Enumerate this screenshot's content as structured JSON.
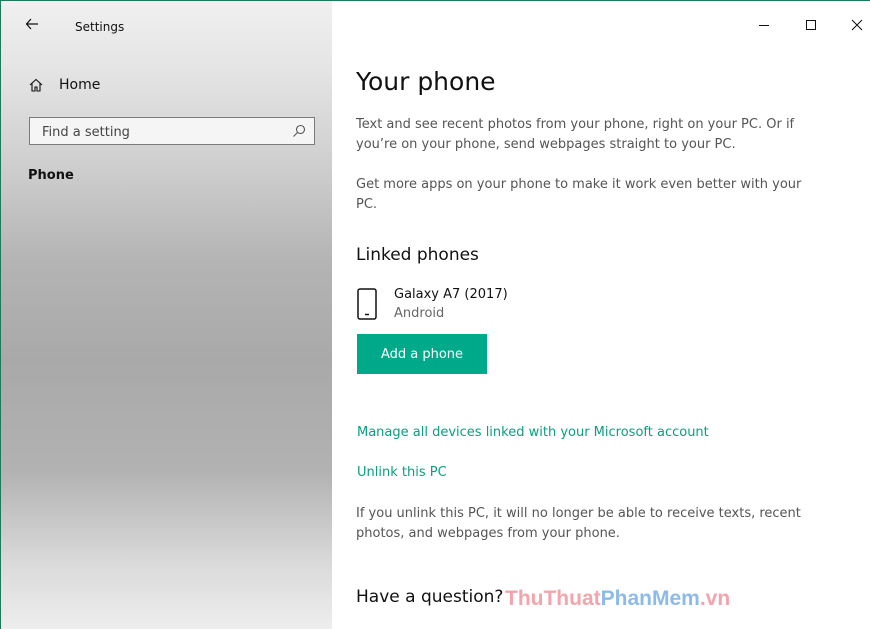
{
  "window": {
    "title": "Settings"
  },
  "sidebar": {
    "home_label": "Home",
    "search_placeholder": "Find a setting",
    "nav_items": [
      {
        "label": "Phone",
        "selected": true
      }
    ]
  },
  "content": {
    "title": "Your phone",
    "intro_1": "Text and see recent photos from your phone, right on your PC. Or if you’re on your phone, send webpages straight to your PC.",
    "intro_2": "Get more apps on your phone to make it work even better with your PC.",
    "linked_phones_heading": "Linked phones",
    "phones": [
      {
        "name": "Galaxy A7 (2017)",
        "os": "Android"
      }
    ],
    "add_phone_label": "Add a phone",
    "manage_link": "Manage all devices linked with your Microsoft account",
    "unlink_link": "Unlink this PC",
    "unlink_note": "If you unlink this PC, it will no longer be able to receive texts, recent photos, and webpages from your phone.",
    "question_heading": "Have a question?"
  },
  "watermark": {
    "part_1": "ThuThuat",
    "part_2": "PhanMem",
    "part_3": ".vn"
  },
  "colors": {
    "accent": "#00a98a",
    "link": "#0a9e83",
    "watermark_pink": "#f4a0a8",
    "watermark_blue": "#86b8e8"
  }
}
